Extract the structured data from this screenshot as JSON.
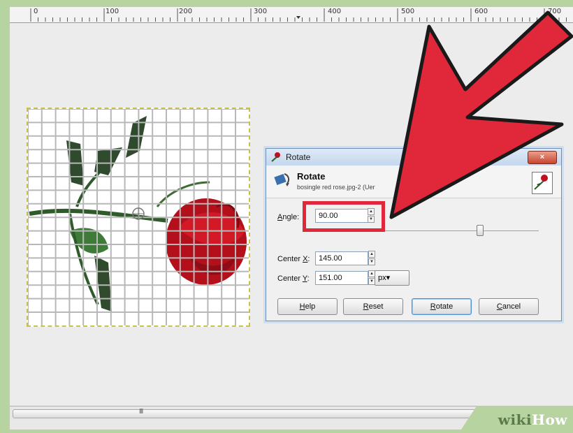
{
  "ruler": {
    "labels": [
      "0",
      "100",
      "200",
      "300",
      "400",
      "500",
      "600",
      "700"
    ]
  },
  "dialog": {
    "window_title": "Rotate",
    "close_label": "×",
    "heading": "Rotate",
    "subheading": "bosingle red rose.jpg-2 (Uer",
    "angle": {
      "label_prefix": "",
      "label_key": "A",
      "label_rest": "ngle:",
      "value": "90.00"
    },
    "center_x": {
      "label_prefix": "Center ",
      "label_key": "X",
      "label_rest": ":",
      "value": "145.00"
    },
    "center_y": {
      "label_prefix": "Center ",
      "label_key": "Y",
      "label_rest": ":",
      "value": "151.00"
    },
    "unit": "px▾",
    "buttons": {
      "help": {
        "key": "H",
        "rest": "elp"
      },
      "reset": {
        "key": "R",
        "rest": "eset"
      },
      "rotate": {
        "key": "R",
        "rest": "otate"
      },
      "cancel": {
        "key": "C",
        "rest": "ancel"
      }
    }
  },
  "scrollbar_grip": "III",
  "watermark": {
    "wiki": "wiki",
    "how": "How"
  },
  "colors": {
    "highlight": "#e0283a",
    "arrow": "#e0283a",
    "rose": "#c0121e",
    "leaf": "#2f5a2a"
  },
  "icons": [
    "rotate-icon",
    "rose-thumbnail-icon",
    "close-icon",
    "spin-up-icon",
    "spin-down-icon",
    "pointer-arrow-icon"
  ]
}
